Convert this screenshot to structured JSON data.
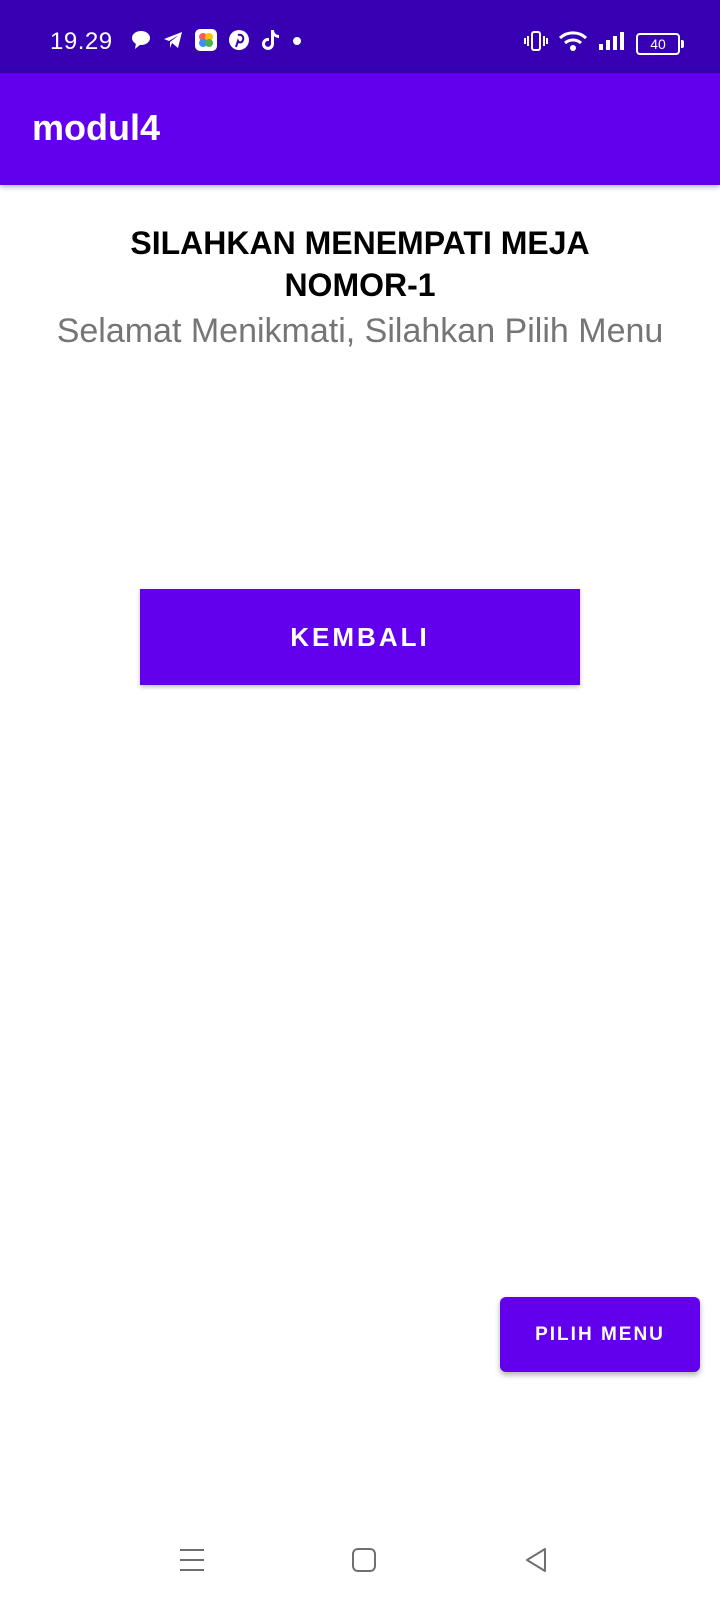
{
  "status_bar": {
    "time": "19.29",
    "battery": "40",
    "left_icons": [
      "chat-icon",
      "telegram-icon",
      "photos-icon",
      "pinterest-icon",
      "tiktok-icon",
      "dot-icon"
    ],
    "right_icons": [
      "vibrate-icon",
      "wifi-icon",
      "signal-icon",
      "battery-icon"
    ]
  },
  "app_bar": {
    "title": "modul4",
    "color": "#6200ee"
  },
  "content": {
    "heading": "SILAHKAN MENEMPATI MEJA NOMOR-1",
    "subheading": "Selamat Menikmati, Silahkan Pilih Menu",
    "back_button_label": "KEMBALI",
    "menu_button_label": "PILIH MENU"
  },
  "nav_bar": {
    "icons": [
      "menu-icon",
      "home-icon",
      "back-icon"
    ]
  },
  "colors": {
    "status_bar": "#3700b3",
    "primary": "#6200ee",
    "subtext": "#757575"
  }
}
